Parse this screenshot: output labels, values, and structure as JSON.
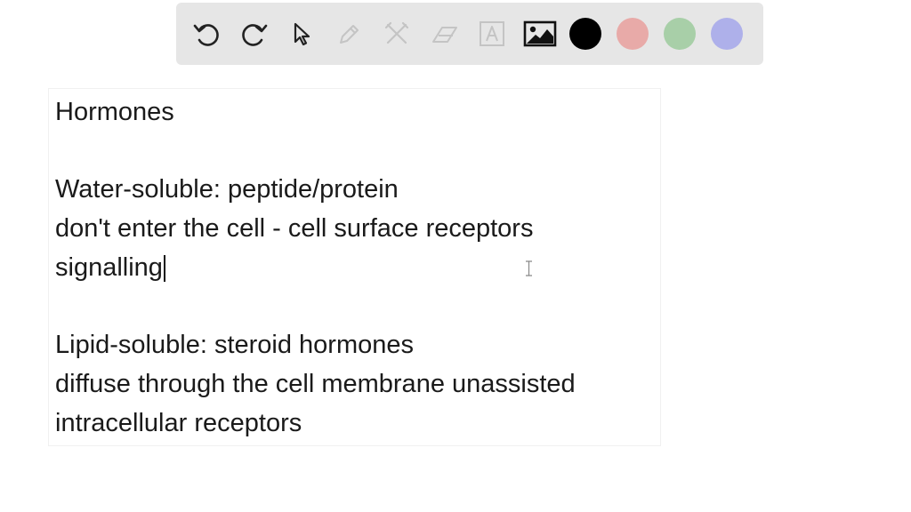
{
  "toolbar": {
    "tools": [
      {
        "name": "undo-icon",
        "enabled": true
      },
      {
        "name": "redo-icon",
        "enabled": true
      },
      {
        "name": "select-pointer-icon",
        "enabled": true
      },
      {
        "name": "pen-icon",
        "enabled": false
      },
      {
        "name": "tools-icon",
        "enabled": false
      },
      {
        "name": "eraser-icon",
        "enabled": false
      },
      {
        "name": "text-tool-icon",
        "enabled": false
      },
      {
        "name": "insert-image-icon",
        "enabled": true
      }
    ],
    "colors": [
      {
        "name": "color-black",
        "hex": "#000000"
      },
      {
        "name": "color-red",
        "hex": "#e8aaa8"
      },
      {
        "name": "color-green",
        "hex": "#a8cfa8"
      },
      {
        "name": "color-blue",
        "hex": "#aeb0ea"
      }
    ]
  },
  "note": {
    "lines": [
      "Hormones",
      "",
      "Water-soluble: peptide/protein",
      "don't enter the cell - cell surface receptors",
      "signalling",
      "",
      "Lipid-soluble: steroid hormones",
      "diffuse through the cell membrane unassisted",
      "intracellular receptors"
    ]
  }
}
